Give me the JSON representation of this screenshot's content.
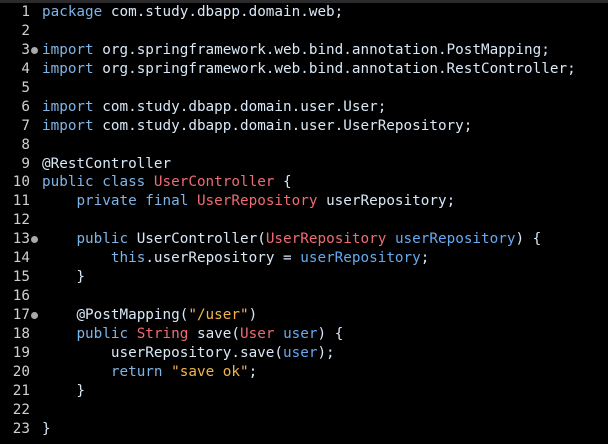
{
  "editor": {
    "lines": [
      {
        "n": "1",
        "fold": false,
        "tokens": [
          {
            "t": "kw",
            "v": "package"
          },
          {
            "t": "plain",
            "v": " com.study.dbapp.domain.web;"
          }
        ]
      },
      {
        "n": "2",
        "fold": false,
        "tokens": []
      },
      {
        "n": "3",
        "fold": true,
        "tokens": [
          {
            "t": "kw",
            "v": "import"
          },
          {
            "t": "plain",
            "v": " org.springframework.web.bind.annotation.PostMapping;"
          }
        ]
      },
      {
        "n": "4",
        "fold": false,
        "tokens": [
          {
            "t": "kw",
            "v": "import"
          },
          {
            "t": "plain",
            "v": " org.springframework.web.bind.annotation.RestController;"
          }
        ]
      },
      {
        "n": "5",
        "fold": false,
        "tokens": []
      },
      {
        "n": "6",
        "fold": false,
        "tokens": [
          {
            "t": "kw",
            "v": "import"
          },
          {
            "t": "plain",
            "v": " com.study.dbapp.domain.user.User;"
          }
        ]
      },
      {
        "n": "7",
        "fold": false,
        "tokens": [
          {
            "t": "kw",
            "v": "import"
          },
          {
            "t": "plain",
            "v": " com.study.dbapp.domain.user.UserRepository;"
          }
        ]
      },
      {
        "n": "8",
        "fold": false,
        "tokens": []
      },
      {
        "n": "9",
        "fold": false,
        "tokens": [
          {
            "t": "ann",
            "v": "@RestController"
          }
        ]
      },
      {
        "n": "10",
        "fold": false,
        "tokens": [
          {
            "t": "kw",
            "v": "public class"
          },
          {
            "t": "plain",
            "v": " "
          },
          {
            "t": "ty",
            "v": "UserController"
          },
          {
            "t": "plain",
            "v": " {"
          }
        ]
      },
      {
        "n": "11",
        "fold": false,
        "tokens": [
          {
            "t": "plain",
            "v": "    "
          },
          {
            "t": "kw",
            "v": "private final"
          },
          {
            "t": "plain",
            "v": " "
          },
          {
            "t": "ty",
            "v": "UserRepository"
          },
          {
            "t": "plain",
            "v": " userRepository;"
          }
        ]
      },
      {
        "n": "12",
        "fold": false,
        "tokens": []
      },
      {
        "n": "13",
        "fold": true,
        "tokens": [
          {
            "t": "plain",
            "v": "    "
          },
          {
            "t": "kw",
            "v": "public"
          },
          {
            "t": "plain",
            "v": " UserController("
          },
          {
            "t": "ty",
            "v": "UserRepository"
          },
          {
            "t": "plain",
            "v": " "
          },
          {
            "t": "fld",
            "v": "userRepository"
          },
          {
            "t": "plain",
            "v": ") {"
          }
        ]
      },
      {
        "n": "14",
        "fold": false,
        "tokens": [
          {
            "t": "plain",
            "v": "        "
          },
          {
            "t": "kw",
            "v": "this"
          },
          {
            "t": "plain",
            "v": ".userRepository = "
          },
          {
            "t": "fld",
            "v": "userRepository"
          },
          {
            "t": "plain",
            "v": ";"
          }
        ]
      },
      {
        "n": "15",
        "fold": false,
        "tokens": [
          {
            "t": "plain",
            "v": "    }"
          }
        ]
      },
      {
        "n": "16",
        "fold": false,
        "tokens": []
      },
      {
        "n": "17",
        "fold": true,
        "tokens": [
          {
            "t": "plain",
            "v": "    "
          },
          {
            "t": "ann",
            "v": "@PostMapping("
          },
          {
            "t": "str",
            "v": "\"/user\""
          },
          {
            "t": "plain",
            "v": ")"
          }
        ]
      },
      {
        "n": "18",
        "fold": false,
        "tokens": [
          {
            "t": "plain",
            "v": "    "
          },
          {
            "t": "kw",
            "v": "public"
          },
          {
            "t": "plain",
            "v": " "
          },
          {
            "t": "ty",
            "v": "String"
          },
          {
            "t": "plain",
            "v": " save("
          },
          {
            "t": "ty",
            "v": "User"
          },
          {
            "t": "plain",
            "v": " "
          },
          {
            "t": "fld",
            "v": "user"
          },
          {
            "t": "plain",
            "v": ") {"
          }
        ]
      },
      {
        "n": "19",
        "fold": false,
        "tokens": [
          {
            "t": "plain",
            "v": "        userRepository.save("
          },
          {
            "t": "fld",
            "v": "user"
          },
          {
            "t": "plain",
            "v": ");"
          }
        ]
      },
      {
        "n": "20",
        "fold": false,
        "tokens": [
          {
            "t": "plain",
            "v": "        "
          },
          {
            "t": "kw",
            "v": "return"
          },
          {
            "t": "plain",
            "v": " "
          },
          {
            "t": "str",
            "v": "\"save ok\""
          },
          {
            "t": "plain",
            "v": ";"
          }
        ]
      },
      {
        "n": "21",
        "fold": false,
        "tokens": [
          {
            "t": "plain",
            "v": "    }"
          }
        ]
      },
      {
        "n": "22",
        "fold": false,
        "tokens": []
      },
      {
        "n": "23",
        "fold": false,
        "tokens": [
          {
            "t": "plain",
            "v": "}"
          }
        ]
      }
    ]
  },
  "colors": {
    "background": "#000000",
    "keyword": "#7fb4e6",
    "type": "#ef6b73",
    "field": "#66a9f2",
    "string": "#f2b64d",
    "plain": "#d9e8f7",
    "line_number": "#d0d0d0"
  },
  "icons": {
    "fold_marker": "fold-marker-icon"
  }
}
